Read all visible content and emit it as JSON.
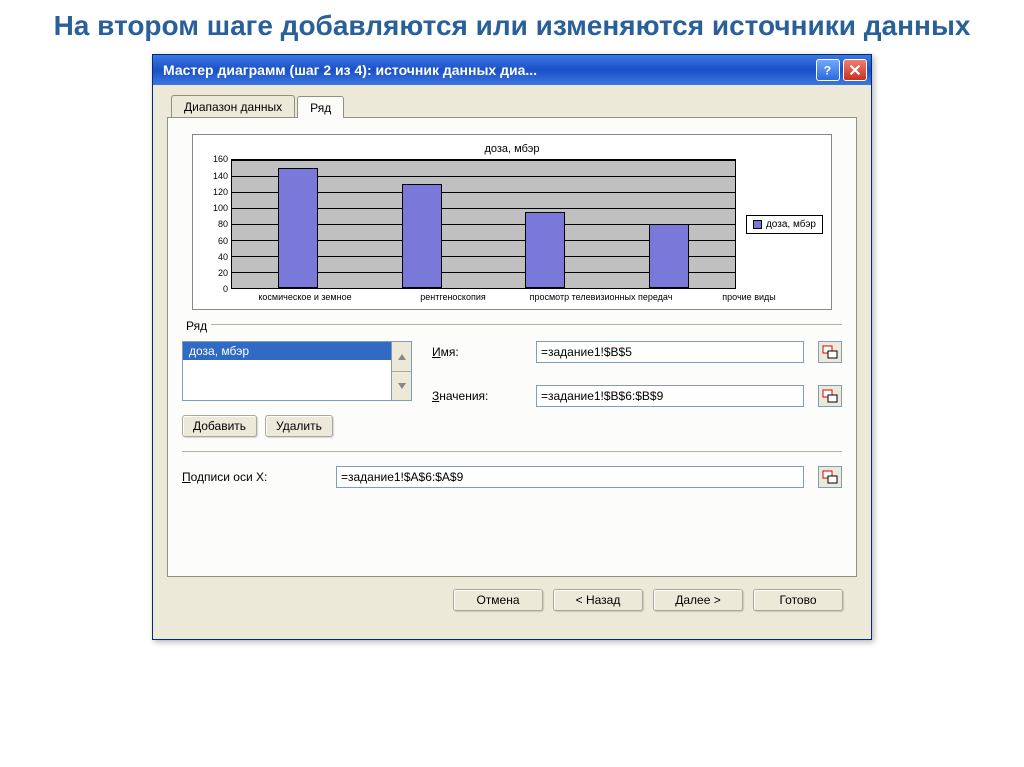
{
  "slide": {
    "heading": "На втором шаге добавляются или изменяются источники данных"
  },
  "titlebar": {
    "text": "Мастер диаграмм (шаг 2 из 4): источник данных диа..."
  },
  "tabs": {
    "data_range": "Диапазон данных",
    "series": "Ряд"
  },
  "chart_data": {
    "type": "bar",
    "title": "доза, мбэр",
    "legend": "доза, мбэр",
    "ylim": [
      0,
      160
    ],
    "yticks": [
      "160",
      "140",
      "120",
      "100",
      "80",
      "60",
      "40",
      "20",
      "0"
    ],
    "categories": [
      "космическое и земное",
      "рентгеноскопия",
      "просмотр телевизионных передач",
      "прочие виды"
    ],
    "values": [
      150,
      130,
      95,
      80
    ]
  },
  "panel": {
    "series_label": "Ряд",
    "series_items": [
      "доза, мбэр"
    ],
    "add_btn": "Добавить",
    "remove_btn": "Удалить",
    "name_label_pre": "И",
    "name_label_post": "мя:",
    "name_value": "=задание1!$B$5",
    "values_label_pre": "З",
    "values_label_post": "начения:",
    "values_value": "=задание1!$B$6:$B$9",
    "axis_label_pre": "П",
    "axis_label_post": "одписи оси X:",
    "axis_value": "=задание1!$A$6:$A$9"
  },
  "footer": {
    "cancel": "Отмена",
    "back": "< Назад",
    "next": "Далее >",
    "finish": "Готово"
  }
}
